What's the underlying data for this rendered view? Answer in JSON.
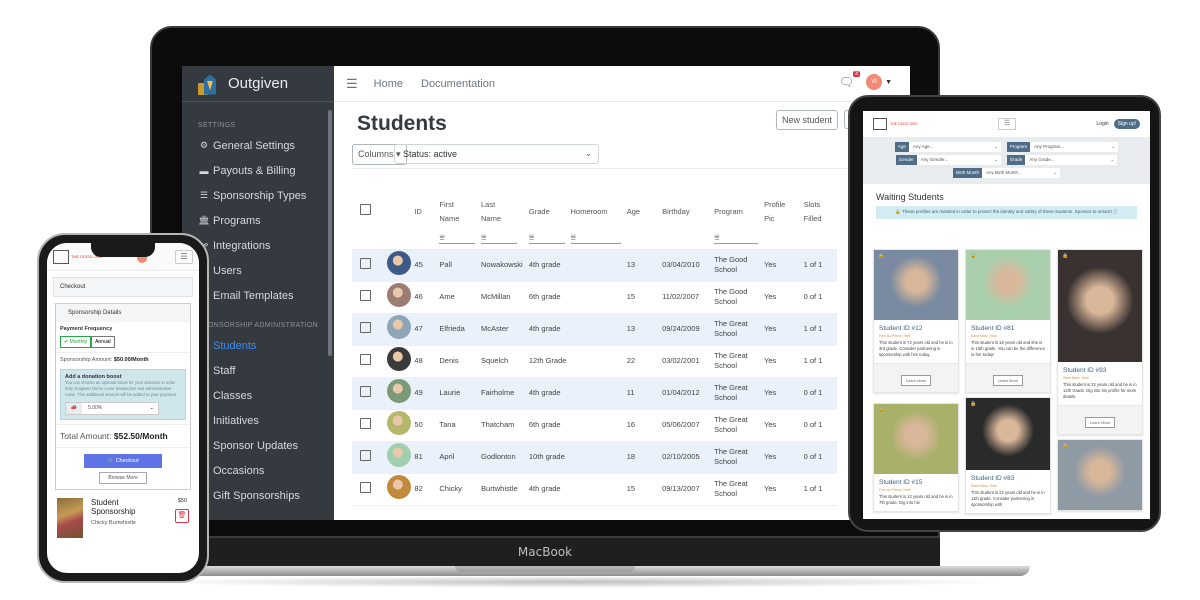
{
  "laptop": {
    "brand_label": "MacBook",
    "sidebar": {
      "brand": "Outgiven",
      "sections": [
        {
          "title": "Settings",
          "items": [
            {
              "label": "General Settings",
              "icon": "gear-icon",
              "glyph": "⚙"
            },
            {
              "label": "Payouts & Billing",
              "icon": "wallet-icon",
              "glyph": "▬"
            },
            {
              "label": "Sponsorship Types",
              "icon": "list-check-icon",
              "glyph": "☰"
            },
            {
              "label": "Programs",
              "icon": "school-icon",
              "glyph": "🏛"
            },
            {
              "label": "Integrations",
              "icon": "plug-icon",
              "glyph": "⚯"
            },
            {
              "label": "Users",
              "icon": "users-icon",
              "glyph": "👥"
            },
            {
              "label": "Email Templates",
              "icon": "envelope-icon",
              "glyph": "✉"
            }
          ]
        },
        {
          "title": "Sponsorship Administration",
          "items": [
            {
              "label": "Students",
              "icon": "student-icon",
              "glyph": "●",
              "active": true
            },
            {
              "label": "Staff",
              "icon": "staff-icon",
              "glyph": "●"
            },
            {
              "label": "Classes",
              "icon": "classes-icon",
              "glyph": "●"
            },
            {
              "label": "Initiatives",
              "icon": "initiatives-icon",
              "glyph": "●"
            },
            {
              "label": "Sponsor Updates",
              "icon": "updates-icon",
              "glyph": "●"
            },
            {
              "label": "Occasions",
              "icon": "occasions-icon",
              "glyph": "●"
            },
            {
              "label": "Gift Sponsorships",
              "icon": "gift-icon",
              "glyph": "●"
            }
          ]
        }
      ]
    },
    "topnav": {
      "links": [
        "Home",
        "Documentation"
      ],
      "notification_count": "3",
      "user_initials": "VI"
    },
    "page": {
      "title": "Students",
      "new_student_label": "New student",
      "columns_label": "Columns ▾",
      "status_filter": "Status: active"
    },
    "table": {
      "headers": [
        "ID",
        "First Name",
        "Last Name",
        "Grade",
        "Homeroom",
        "Age",
        "Birthday",
        "Program",
        "Profile Pic",
        "Slots Filled"
      ],
      "rows": [
        {
          "id": "45",
          "first": "Pall",
          "last": "Nowakowski",
          "grade": "4th grade",
          "homeroom": "",
          "age": "13",
          "birthday": "03/04/2010",
          "program": "The Good School",
          "pic": "Yes",
          "slots": "1 of 1",
          "avatar_color": "#3e5a86"
        },
        {
          "id": "46",
          "first": "Ame",
          "last": "McMillan",
          "grade": "6th grade",
          "homeroom": "",
          "age": "15",
          "birthday": "11/02/2007",
          "program": "The Good School",
          "pic": "Yes",
          "slots": "0 of 1",
          "avatar_color": "#9b7d74"
        },
        {
          "id": "47",
          "first": "Elfrieda",
          "last": "McAster",
          "grade": "4th grade",
          "homeroom": "",
          "age": "13",
          "birthday": "09/24/2009",
          "program": "The Great School",
          "pic": "Yes",
          "slots": "1 of 1",
          "avatar_color": "#8fa6b8"
        },
        {
          "id": "48",
          "first": "Denis",
          "last": "Squelch",
          "grade": "12th Grade",
          "homeroom": "",
          "age": "22",
          "birthday": "03/02/2001",
          "program": "The Great School",
          "pic": "Yes",
          "slots": "1 of 1",
          "avatar_color": "#3a3a3a"
        },
        {
          "id": "49",
          "first": "Laurie",
          "last": "Fairholme",
          "grade": "4th grade",
          "homeroom": "",
          "age": "11",
          "birthday": "01/04/2012",
          "program": "The Great School",
          "pic": "Yes",
          "slots": "0 of 1",
          "avatar_color": "#7d9a78"
        },
        {
          "id": "50",
          "first": "Tana",
          "last": "Thatcham",
          "grade": "6th grade",
          "homeroom": "",
          "age": "16",
          "birthday": "05/06/2007",
          "program": "The Great School",
          "pic": "Yes",
          "slots": "0 of 1",
          "avatar_color": "#b5b86a"
        },
        {
          "id": "81",
          "first": "April",
          "last": "Godlonton",
          "grade": "10th grade",
          "homeroom": "",
          "age": "18",
          "birthday": "02/10/2005",
          "program": "The Great School",
          "pic": "Yes",
          "slots": "0 of 1",
          "avatar_color": "#9fcfae"
        },
        {
          "id": "82",
          "first": "Chicky",
          "last": "Burtwhistle",
          "grade": "4th grade",
          "homeroom": "",
          "age": "15",
          "birthday": "09/13/2007",
          "program": "The Great School",
          "pic": "Yes",
          "slots": "1 of 1",
          "avatar_color": "#c18a3c"
        }
      ]
    }
  },
  "phone": {
    "checkout_title": "Checkout",
    "details_title": "Sponsorship Details",
    "payment_frequency_label": "Payment Frequency",
    "frequency_options": [
      "✔ Monthly",
      "Annual"
    ],
    "frequency_selected": "Monthly",
    "amount_label": "Sponsorship Amount:",
    "amount_value": "$50.00/Month",
    "boost_title": "Add a donation boost",
    "boost_text": "You can choose an optional boost for your donation in order help Outgiven Demo cover transaction and administrative costs. This additional amount will be added to your payment.",
    "boost_value": "5.00%",
    "total_label": "Total Amount:",
    "total_value": "$52.50/Month",
    "checkout_button": "🛒 Checkout",
    "browse_button": "Browse More",
    "cart_item": {
      "title": "Student Sponsorship",
      "subtitle": "Chicky Burtwhistle",
      "price": "$50"
    }
  },
  "tablet": {
    "login_label": "Login",
    "signup_label": "Sign up!",
    "filters": [
      {
        "label": "Age",
        "value": "Any Age..."
      },
      {
        "label": "Program",
        "value": "Any Program..."
      },
      {
        "label": "Gender",
        "value": "Any Gender..."
      },
      {
        "label": "Grade",
        "value": "Any Grade..."
      },
      {
        "label": "Birth Month",
        "value": "Any Birth Month..."
      }
    ],
    "section_title": "Waiting Students",
    "alert": "🔒 These profiles are masked in order to protect the identity and safety of these students. Sponsor to unlock! ⓘ",
    "learn_more_label": "Learn More",
    "cards": [
      {
        "title": "Student ID #12",
        "location": "Port-au-Prince, Haiti",
        "desc": "This student is 72 years old and he is in 3rd grade. Consider partnering in sponsorship with him today.",
        "color": "#7a8aa0"
      },
      {
        "title": "Student ID #81",
        "location": "Saint Marc, Haiti",
        "desc": "This student is 18 years old and she is in 10th grade. You can be the difference to her today!",
        "color": "#a9cfae"
      },
      {
        "title": "Student ID #93",
        "location": "Saint Marc, Haiti",
        "desc": "This student is 22 years old and he is in 12th Grade. Dig into his profile for more details.",
        "color": "#3a3230"
      },
      {
        "title": "Student ID #15",
        "location": "Port-au-Prince, Haiti",
        "desc": "This student is 12 years old and he is in 7th grade. Dig into his",
        "color": "#a8b06a"
      },
      {
        "title": "Student ID #83",
        "location": "Saint Marc, Haiti",
        "desc": "This student is 22 years old and he is in 11th grade. Consider partnering in sponsorship with",
        "color": "#2a2a2a"
      },
      {
        "title": "",
        "location": "",
        "desc": "",
        "color": "#8e9aa4"
      }
    ]
  }
}
